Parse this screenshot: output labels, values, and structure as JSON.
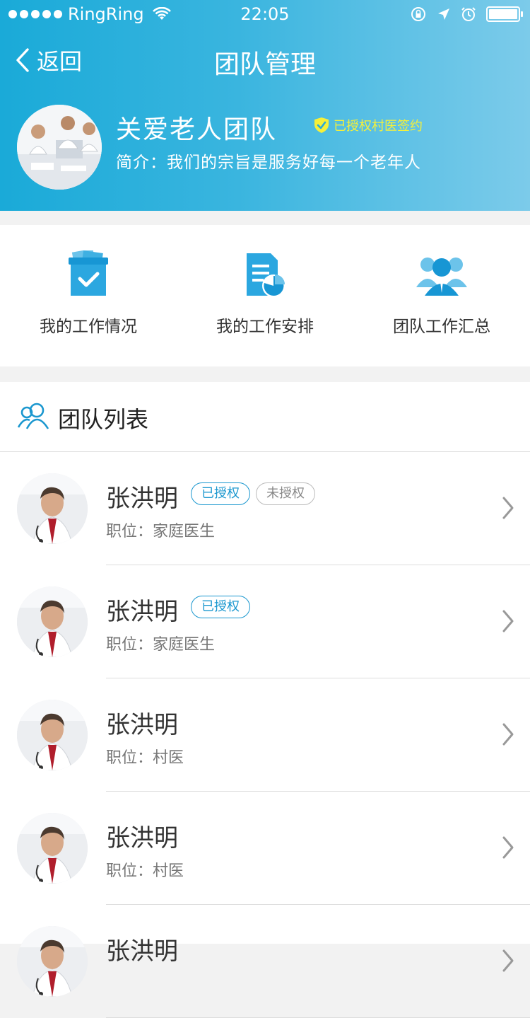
{
  "status_bar": {
    "carrier": "RingRing",
    "time": "22:05"
  },
  "nav": {
    "back_label": "返回",
    "title": "团队管理"
  },
  "team": {
    "name": "关爱老人团队",
    "auth_label": "已授权村医签约",
    "intro": "简介：我们的宗旨是服务好每一个老年人"
  },
  "actions": [
    {
      "label": "我的工作情况",
      "icon": "clipboard-check-icon"
    },
    {
      "label": "我的工作安排",
      "icon": "document-chart-icon"
    },
    {
      "label": "团队工作汇总",
      "icon": "team-group-icon"
    }
  ],
  "list": {
    "title": "团队列表",
    "members": [
      {
        "name": "张洪明",
        "position": "职位：家庭医生",
        "tags": [
          "已授权",
          "未授权"
        ]
      },
      {
        "name": "张洪明",
        "position": "职位：家庭医生",
        "tags": [
          "已授权"
        ]
      },
      {
        "name": "张洪明",
        "position": "职位：村医",
        "tags": []
      },
      {
        "name": "张洪明",
        "position": "职位：村医",
        "tags": []
      },
      {
        "name": "张洪明",
        "position": "",
        "tags": []
      }
    ]
  },
  "colors": {
    "accent": "#1a97cf",
    "header_start": "#1aaad8",
    "header_end": "#7ccbea",
    "badge_yellow": "#f5f03a"
  }
}
